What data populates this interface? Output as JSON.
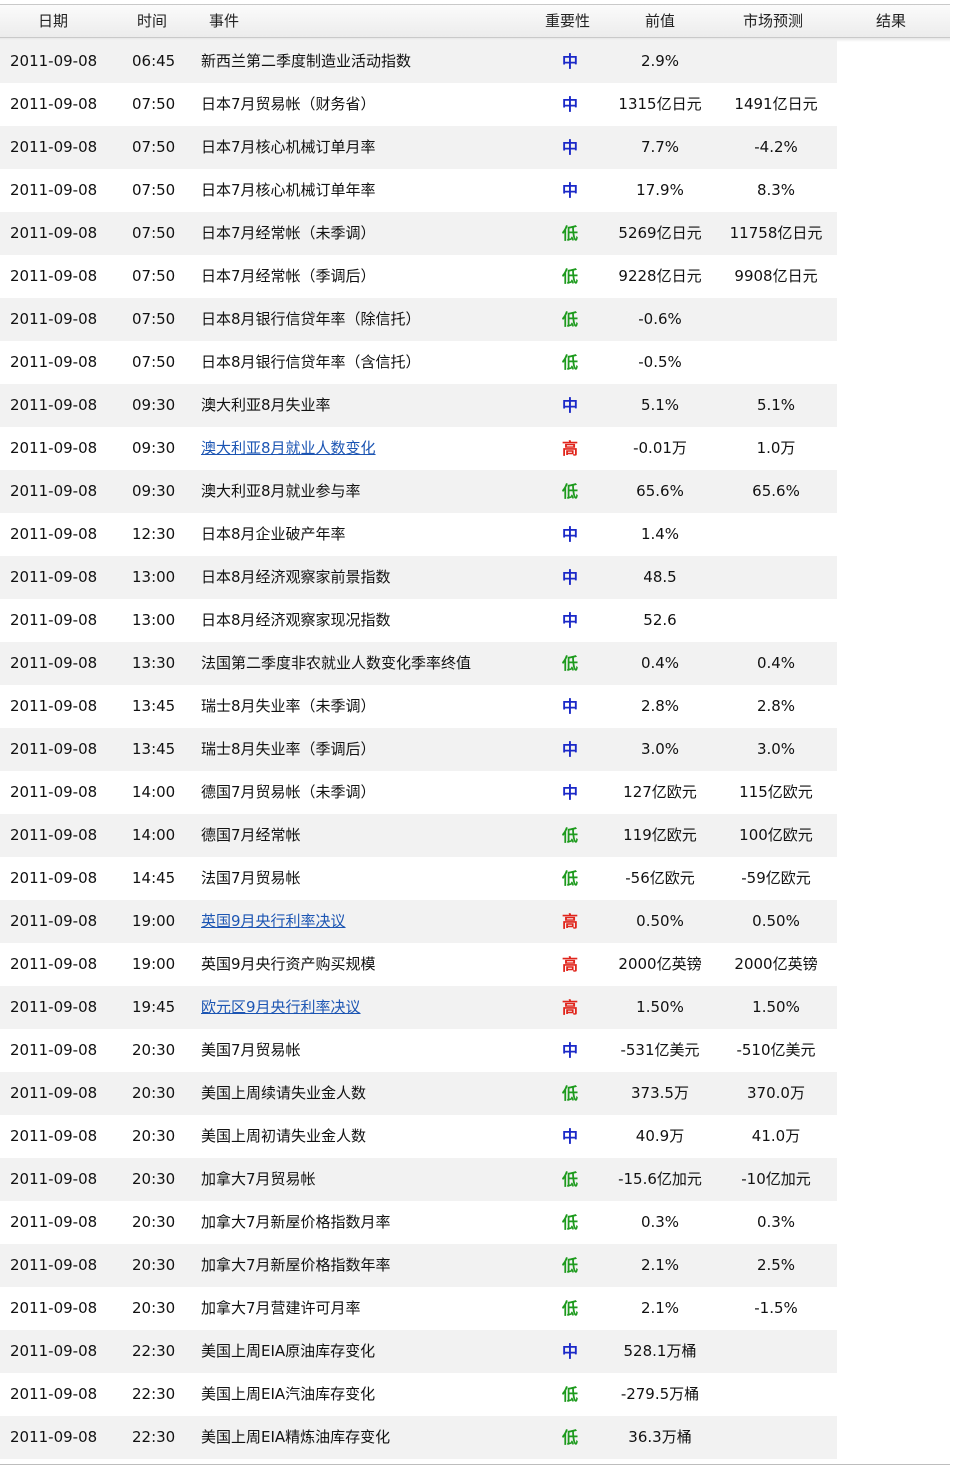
{
  "header": {
    "date": "日期",
    "time": "时间",
    "event": "事件",
    "importance": "重要性",
    "previous": "前值",
    "forecast": "市场预测",
    "result": "结果"
  },
  "rows": [
    {
      "date": "2011-09-08",
      "time": "06:45",
      "event": "新西兰第二季度制造业活动指数",
      "importance": "中",
      "level": "mid",
      "previous": "2.9%",
      "forecast": "",
      "link": false
    },
    {
      "date": "2011-09-08",
      "time": "07:50",
      "event": "日本7月贸易帐（财务省）",
      "importance": "中",
      "level": "mid",
      "previous": "1315亿日元",
      "forecast": "1491亿日元",
      "link": false
    },
    {
      "date": "2011-09-08",
      "time": "07:50",
      "event": "日本7月核心机械订单月率",
      "importance": "中",
      "level": "mid",
      "previous": "7.7%",
      "forecast": "-4.2%",
      "link": false
    },
    {
      "date": "2011-09-08",
      "time": "07:50",
      "event": "日本7月核心机械订单年率",
      "importance": "中",
      "level": "mid",
      "previous": "17.9%",
      "forecast": "8.3%",
      "link": false
    },
    {
      "date": "2011-09-08",
      "time": "07:50",
      "event": "日本7月经常帐（未季调）",
      "importance": "低",
      "level": "low",
      "previous": "5269亿日元",
      "forecast": "11758亿日元",
      "link": false
    },
    {
      "date": "2011-09-08",
      "time": "07:50",
      "event": "日本7月经常帐（季调后）",
      "importance": "低",
      "level": "low",
      "previous": "9228亿日元",
      "forecast": "9908亿日元",
      "link": false
    },
    {
      "date": "2011-09-08",
      "time": "07:50",
      "event": "日本8月银行信贷年率（除信托）",
      "importance": "低",
      "level": "low",
      "previous": "-0.6%",
      "forecast": "",
      "link": false
    },
    {
      "date": "2011-09-08",
      "time": "07:50",
      "event": "日本8月银行信贷年率（含信托）",
      "importance": "低",
      "level": "low",
      "previous": "-0.5%",
      "forecast": "",
      "link": false
    },
    {
      "date": "2011-09-08",
      "time": "09:30",
      "event": "澳大利亚8月失业率",
      "importance": "中",
      "level": "mid",
      "previous": "5.1%",
      "forecast": "5.1%",
      "link": false
    },
    {
      "date": "2011-09-08",
      "time": "09:30",
      "event": "澳大利亚8月就业人数变化",
      "importance": "高",
      "level": "high",
      "previous": "-0.01万",
      "forecast": "1.0万",
      "link": true
    },
    {
      "date": "2011-09-08",
      "time": "09:30",
      "event": "澳大利亚8月就业参与率",
      "importance": "低",
      "level": "low",
      "previous": "65.6%",
      "forecast": "65.6%",
      "link": false
    },
    {
      "date": "2011-09-08",
      "time": "12:30",
      "event": "日本8月企业破产年率",
      "importance": "中",
      "level": "mid",
      "previous": "1.4%",
      "forecast": "",
      "link": false
    },
    {
      "date": "2011-09-08",
      "time": "13:00",
      "event": "日本8月经济观察家前景指数",
      "importance": "中",
      "level": "mid",
      "previous": "48.5",
      "forecast": "",
      "link": false
    },
    {
      "date": "2011-09-08",
      "time": "13:00",
      "event": "日本8月经济观察家现况指数",
      "importance": "中",
      "level": "mid",
      "previous": "52.6",
      "forecast": "",
      "link": false
    },
    {
      "date": "2011-09-08",
      "time": "13:30",
      "event": "法国第二季度非农就业人数变化季率终值",
      "importance": "低",
      "level": "low",
      "previous": "0.4%",
      "forecast": "0.4%",
      "link": false
    },
    {
      "date": "2011-09-08",
      "time": "13:45",
      "event": "瑞士8月失业率（未季调）",
      "importance": "中",
      "level": "mid",
      "previous": "2.8%",
      "forecast": "2.8%",
      "link": false
    },
    {
      "date": "2011-09-08",
      "time": "13:45",
      "event": "瑞士8月失业率（季调后）",
      "importance": "中",
      "level": "mid",
      "previous": "3.0%",
      "forecast": "3.0%",
      "link": false
    },
    {
      "date": "2011-09-08",
      "time": "14:00",
      "event": "德国7月贸易帐（未季调）",
      "importance": "中",
      "level": "mid",
      "previous": "127亿欧元",
      "forecast": "115亿欧元",
      "link": false
    },
    {
      "date": "2011-09-08",
      "time": "14:00",
      "event": "德国7月经常帐",
      "importance": "低",
      "level": "low",
      "previous": "119亿欧元",
      "forecast": "100亿欧元",
      "link": false
    },
    {
      "date": "2011-09-08",
      "time": "14:45",
      "event": "法国7月贸易帐",
      "importance": "低",
      "level": "low",
      "previous": "-56亿欧元",
      "forecast": "-59亿欧元",
      "link": false
    },
    {
      "date": "2011-09-08",
      "time": "19:00",
      "event": "英国9月央行利率决议",
      "importance": "高",
      "level": "high",
      "previous": "0.50%",
      "forecast": "0.50%",
      "link": true
    },
    {
      "date": "2011-09-08",
      "time": "19:00",
      "event": "英国9月央行资产购买规模",
      "importance": "高",
      "level": "high",
      "previous": "2000亿英镑",
      "forecast": "2000亿英镑",
      "link": false
    },
    {
      "date": "2011-09-08",
      "time": "19:45",
      "event": "欧元区9月央行利率决议",
      "importance": "高",
      "level": "high",
      "previous": "1.50%",
      "forecast": "1.50%",
      "link": true
    },
    {
      "date": "2011-09-08",
      "time": "20:30",
      "event": "美国7月贸易帐",
      "importance": "中",
      "level": "mid",
      "previous": "-531亿美元",
      "forecast": "-510亿美元",
      "link": false
    },
    {
      "date": "2011-09-08",
      "time": "20:30",
      "event": "美国上周续请失业金人数",
      "importance": "低",
      "level": "low",
      "previous": "373.5万",
      "forecast": "370.0万",
      "link": false
    },
    {
      "date": "2011-09-08",
      "time": "20:30",
      "event": "美国上周初请失业金人数",
      "importance": "中",
      "level": "mid",
      "previous": "40.9万",
      "forecast": "41.0万",
      "link": false
    },
    {
      "date": "2011-09-08",
      "time": "20:30",
      "event": "加拿大7月贸易帐",
      "importance": "低",
      "level": "low",
      "previous": "-15.6亿加元",
      "forecast": "-10亿加元",
      "link": false
    },
    {
      "date": "2011-09-08",
      "time": "20:30",
      "event": "加拿大7月新屋价格指数月率",
      "importance": "低",
      "level": "low",
      "previous": "0.3%",
      "forecast": "0.3%",
      "link": false
    },
    {
      "date": "2011-09-08",
      "time": "20:30",
      "event": "加拿大7月新屋价格指数年率",
      "importance": "低",
      "level": "low",
      "previous": "2.1%",
      "forecast": "2.5%",
      "link": false
    },
    {
      "date": "2011-09-08",
      "time": "20:30",
      "event": "加拿大7月营建许可月率",
      "importance": "低",
      "level": "low",
      "previous": "2.1%",
      "forecast": "-1.5%",
      "link": false
    },
    {
      "date": "2011-09-08",
      "time": "22:30",
      "event": "美国上周EIA原油库存变化",
      "importance": "中",
      "level": "mid",
      "previous": "528.1万桶",
      "forecast": "",
      "link": false
    },
    {
      "date": "2011-09-08",
      "time": "22:30",
      "event": "美国上周EIA汽油库存变化",
      "importance": "低",
      "level": "low",
      "previous": "-279.5万桶",
      "forecast": "",
      "link": false
    },
    {
      "date": "2011-09-08",
      "time": "22:30",
      "event": "美国上周EIA精炼油库存变化",
      "importance": "低",
      "level": "low",
      "previous": "36.3万桶",
      "forecast": "",
      "link": false
    }
  ]
}
